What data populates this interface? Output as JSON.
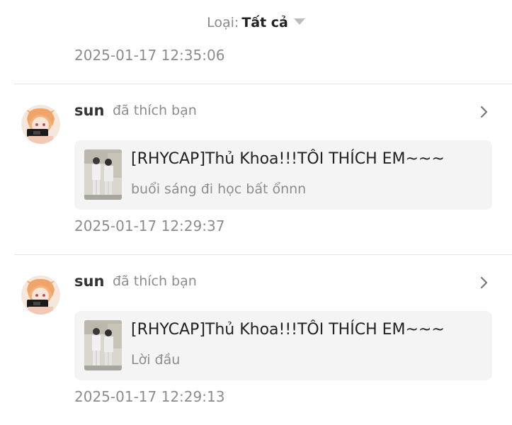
{
  "filter": {
    "label": "Loại:",
    "value": "Tất cả",
    "icon": "caret-down-icon"
  },
  "top_timestamp": "2025-01-17 12:35:06",
  "notifications": [
    {
      "user": "sun",
      "action": "đã thích bạn",
      "post_title": "[RHYCAP]Thủ Khoa!!!TÔI THÍCH EM~~~",
      "post_subtitle": "buổi sáng đi học bất ổnnn",
      "timestamp": "2025-01-17 12:29:37"
    },
    {
      "user": "sun",
      "action": "đã thích bạn",
      "post_title": "[RHYCAP]Thủ Khoa!!!TÔI THÍCH EM~~~",
      "post_subtitle": "Lời đầu",
      "timestamp": "2025-01-17 12:29:13"
    }
  ],
  "colors": {
    "muted_text": "#8c8c8c",
    "card_bg": "#f4f4f4",
    "divider": "#e6e6e6"
  }
}
